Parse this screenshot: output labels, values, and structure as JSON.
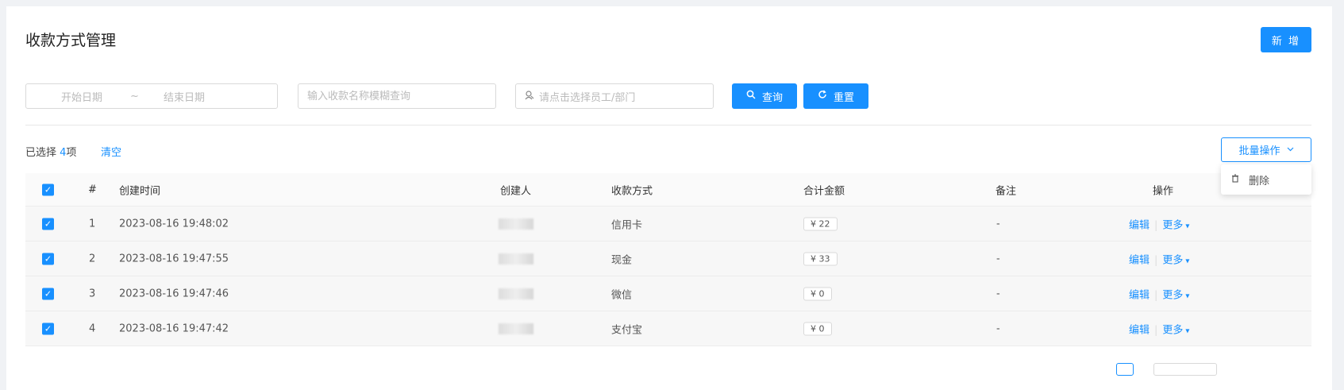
{
  "header": {
    "title": "收款方式管理",
    "new_label": "新 增"
  },
  "filters": {
    "start_date": "开始日期",
    "date_sep": "~",
    "end_date": "结束日期",
    "name_placeholder": "输入收款名称模糊查询",
    "employee_placeholder": "请点击选择员工/部门",
    "query_label": "查询",
    "reset_label": "重置"
  },
  "selection": {
    "prefix": "已选择 ",
    "count": "4",
    "suffix": "项",
    "clear_label": "清空"
  },
  "batch": {
    "label": "批量操作",
    "menu_delete": "删除"
  },
  "table": {
    "columns": {
      "index": "#",
      "created_at": "创建时间",
      "creator": "创建人",
      "method": "收款方式",
      "total": "合计金额",
      "remark": "备注",
      "ops": "操作"
    },
    "rows": [
      {
        "index": "1",
        "created_at": "2023-08-16 19:48:02",
        "method": "信用卡",
        "total": "¥ 22",
        "remark": "-"
      },
      {
        "index": "2",
        "created_at": "2023-08-16 19:47:55",
        "method": "现金",
        "total": "¥ 33",
        "remark": "-"
      },
      {
        "index": "3",
        "created_at": "2023-08-16 19:47:46",
        "method": "微信",
        "total": "¥ 0",
        "remark": "-"
      },
      {
        "index": "4",
        "created_at": "2023-08-16 19:47:42",
        "method": "支付宝",
        "total": "¥ 0",
        "remark": "-"
      }
    ],
    "edit_label": "编辑",
    "more_label": "更多"
  },
  "colors": {
    "primary": "#1890ff",
    "border": "#d9d9d9",
    "header_bg": "#fafafa"
  }
}
